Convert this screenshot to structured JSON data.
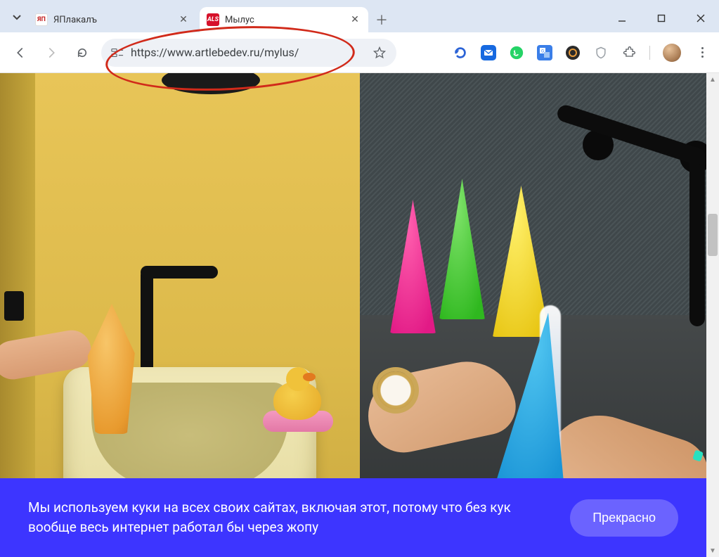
{
  "window": {
    "tabs": [
      {
        "title": "ЯПлакалъ",
        "active": false,
        "favicon_bg": "#ffffff",
        "favicon_text": "ЯП",
        "favicon_color": "#c21a1a"
      },
      {
        "title": "Мылус",
        "active": true,
        "favicon_bg": "#d6112a",
        "favicon_text": "ALS",
        "favicon_color": "#ffffff"
      }
    ]
  },
  "toolbar": {
    "url": "https://www.artlebedev.ru/mylus/"
  },
  "cookie": {
    "text": "Мы используем куки на всех своих сайтах, включая этот, потому что без кук вообще весь интернет работал бы через жопу",
    "button": "Прекрасно"
  },
  "colors": {
    "banner_bg": "#3d35ff",
    "banner_btn": "#6b63ff",
    "annotation": "#d12a1a"
  }
}
